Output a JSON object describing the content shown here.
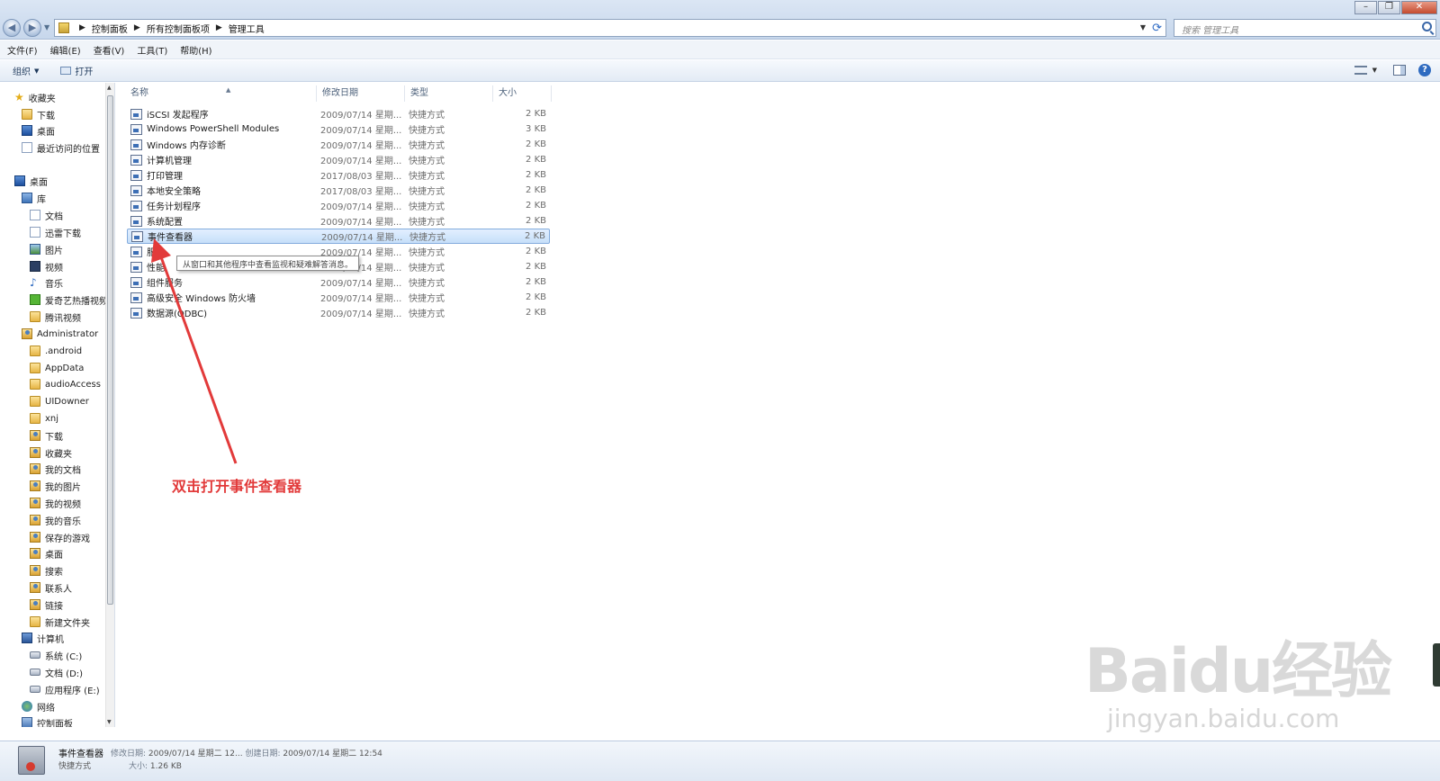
{
  "address": {
    "crumbs": [
      "控制面板",
      "所有控制面板项",
      "管理工具"
    ],
    "search_placeholder": "搜索 管理工具"
  },
  "menu": [
    "文件(F)",
    "编辑(E)",
    "查看(V)",
    "工具(T)",
    "帮助(H)"
  ],
  "toolbar": {
    "organize": "组织",
    "open": "打开"
  },
  "sidebar": {
    "favorites": "收藏夹",
    "fav_items": [
      "下载",
      "桌面",
      "最近访问的位置"
    ],
    "desktop": "桌面",
    "library": "库",
    "lib_items": [
      "文档",
      "迅雷下载",
      "图片",
      "视频",
      "音乐",
      "爱奇艺热播视频",
      "腾讯视频"
    ],
    "user": "Administrator",
    "user_items": [
      ".android",
      "AppData",
      "audioAccess",
      "UIDowner",
      "xnj",
      "下载",
      "收藏夹",
      "我的文档",
      "我的图片",
      "我的视频",
      "我的音乐",
      "保存的游戏",
      "桌面",
      "搜索",
      "联系人",
      "链接",
      "新建文件夹"
    ],
    "computer": "计算机",
    "drives": [
      "系统 (C:)",
      "文档 (D:)",
      "应用程序 (E:)"
    ],
    "network": "网络",
    "control_panel": "控制面板"
  },
  "columns": {
    "name": "名称",
    "date": "修改日期",
    "type": "类型",
    "size": "大小"
  },
  "files": [
    {
      "name": "iSCSI 发起程序",
      "date": "2009/07/14 星期...",
      "type": "快捷方式",
      "size": "2 KB"
    },
    {
      "name": "Windows PowerShell Modules",
      "date": "2009/07/14 星期...",
      "type": "快捷方式",
      "size": "3 KB"
    },
    {
      "name": "Windows 内存诊断",
      "date": "2009/07/14 星期...",
      "type": "快捷方式",
      "size": "2 KB"
    },
    {
      "name": "计算机管理",
      "date": "2009/07/14 星期...",
      "type": "快捷方式",
      "size": "2 KB"
    },
    {
      "name": "打印管理",
      "date": "2017/08/03 星期...",
      "type": "快捷方式",
      "size": "2 KB"
    },
    {
      "name": "本地安全策略",
      "date": "2017/08/03 星期...",
      "type": "快捷方式",
      "size": "2 KB"
    },
    {
      "name": "任务计划程序",
      "date": "2009/07/14 星期...",
      "type": "快捷方式",
      "size": "2 KB"
    },
    {
      "name": "系统配置",
      "date": "2009/07/14 星期...",
      "type": "快捷方式",
      "size": "2 KB"
    },
    {
      "name": "事件查看器",
      "date": "2009/07/14 星期...",
      "type": "快捷方式",
      "size": "2 KB"
    },
    {
      "name": "服",
      "date": "2009/07/14 星期...",
      "type": "快捷方式",
      "size": "2 KB"
    },
    {
      "name": "性能",
      "date": "2009/07/14 星期...",
      "type": "快捷方式",
      "size": "2 KB"
    },
    {
      "name": "组件服务",
      "date": "2009/07/14 星期...",
      "type": "快捷方式",
      "size": "2 KB"
    },
    {
      "name": "高级安全 Windows 防火墙",
      "date": "2009/07/14 星期...",
      "type": "快捷方式",
      "size": "2 KB"
    },
    {
      "name": "数据源(ODBC)",
      "date": "2009/07/14 星期...",
      "type": "快捷方式",
      "size": "2 KB"
    }
  ],
  "tooltip": "从窗口和其他程序中查看监视和疑难解答消息。",
  "annotation": "双击打开事件查看器",
  "watermark": {
    "logo": "Baidu经验",
    "url": "jingyan.baidu.com"
  },
  "details": {
    "name": "事件查看器",
    "type": "快捷方式",
    "modified_label": "修改日期:",
    "modified": "2009/07/14 星期二 12...",
    "created_label": "创建日期:",
    "created": "2009/07/14 星期二 12:54",
    "size_label": "大小:",
    "size": "1.26 KB"
  },
  "colors": {
    "annotation": "#e23a3a",
    "selection": "#c6dff9",
    "accent": "#2f6bc0"
  }
}
